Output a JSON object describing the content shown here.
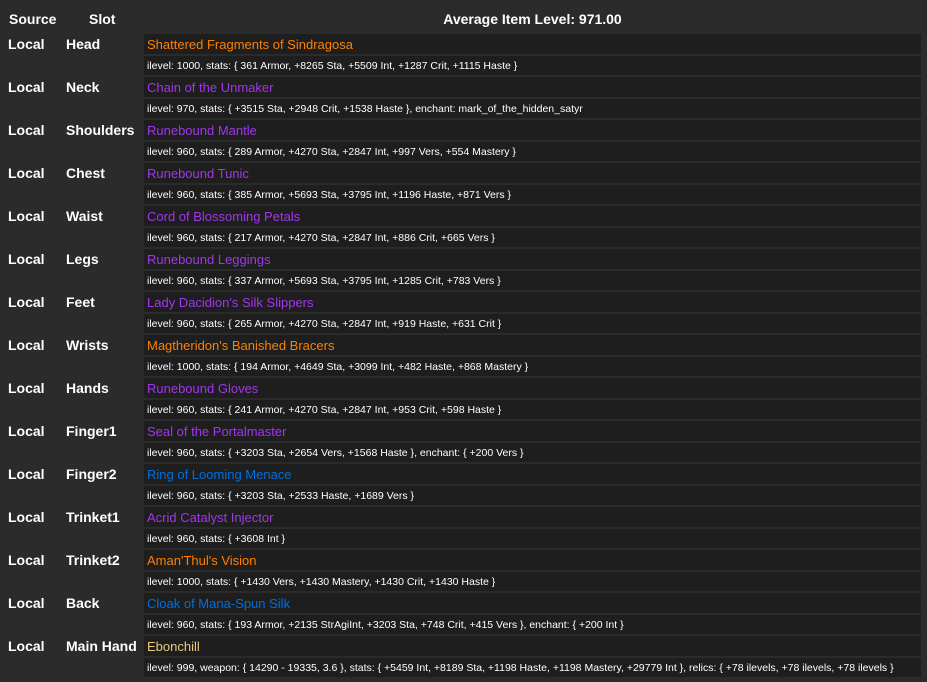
{
  "header": {
    "source": "Source",
    "slot": "Slot",
    "average_item_level": "Average Item Level: 971.00"
  },
  "quality_colors": {
    "legendary": "#ff8000",
    "epic": "#a335ee",
    "rare": "#0070dd",
    "artifact": "#e6cc80"
  },
  "items": [
    {
      "source": "Local",
      "slot": "Head",
      "name": "Shattered Fragments of Sindragosa",
      "quality": "legendary",
      "stats": "ilevel: 1000, stats: { 361 Armor, +8265 Sta, +5509 Int, +1287 Crit, +1115 Haste }"
    },
    {
      "source": "Local",
      "slot": "Neck",
      "name": "Chain of the Unmaker",
      "quality": "epic",
      "stats": "ilevel: 970, stats: { +3515 Sta, +2948 Crit, +1538 Haste }, enchant: mark_of_the_hidden_satyr"
    },
    {
      "source": "Local",
      "slot": "Shoulders",
      "name": "Runebound Mantle",
      "quality": "epic",
      "stats": "ilevel: 960, stats: { 289 Armor, +4270 Sta, +2847 Int, +997 Vers, +554 Mastery }"
    },
    {
      "source": "Local",
      "slot": "Chest",
      "name": "Runebound Tunic",
      "quality": "epic",
      "stats": "ilevel: 960, stats: { 385 Armor, +5693 Sta, +3795 Int, +1196 Haste, +871 Vers }"
    },
    {
      "source": "Local",
      "slot": "Waist",
      "name": "Cord of Blossoming Petals",
      "quality": "epic",
      "stats": "ilevel: 960, stats: { 217 Armor, +4270 Sta, +2847 Int, +886 Crit, +665 Vers }"
    },
    {
      "source": "Local",
      "slot": "Legs",
      "name": "Runebound Leggings",
      "quality": "epic",
      "stats": "ilevel: 960, stats: { 337 Armor, +5693 Sta, +3795 Int, +1285 Crit, +783 Vers }"
    },
    {
      "source": "Local",
      "slot": "Feet",
      "name": "Lady Dacidion's Silk Slippers",
      "quality": "epic",
      "stats": "ilevel: 960, stats: { 265 Armor, +4270 Sta, +2847 Int, +919 Haste, +631 Crit }"
    },
    {
      "source": "Local",
      "slot": "Wrists",
      "name": "Magtheridon's Banished Bracers",
      "quality": "legendary",
      "stats": "ilevel: 1000, stats: { 194 Armor, +4649 Sta, +3099 Int, +482 Haste, +868 Mastery }"
    },
    {
      "source": "Local",
      "slot": "Hands",
      "name": "Runebound Gloves",
      "quality": "epic",
      "stats": "ilevel: 960, stats: { 241 Armor, +4270 Sta, +2847 Int, +953 Crit, +598 Haste }"
    },
    {
      "source": "Local",
      "slot": "Finger1",
      "name": "Seal of the Portalmaster",
      "quality": "epic",
      "stats": "ilevel: 960, stats: { +3203 Sta, +2654 Vers, +1568 Haste }, enchant: { +200 Vers }"
    },
    {
      "source": "Local",
      "slot": "Finger2",
      "name": "Ring of Looming Menace",
      "quality": "rare",
      "stats": "ilevel: 960, stats: { +3203 Sta, +2533 Haste, +1689 Vers }"
    },
    {
      "source": "Local",
      "slot": "Trinket1",
      "name": "Acrid Catalyst Injector",
      "quality": "epic",
      "stats": "ilevel: 960, stats: { +3608 Int }"
    },
    {
      "source": "Local",
      "slot": "Trinket2",
      "name": "Aman'Thul's Vision",
      "quality": "legendary",
      "stats": "ilevel: 1000, stats: { +1430 Vers, +1430 Mastery, +1430 Crit, +1430 Haste }"
    },
    {
      "source": "Local",
      "slot": "Back",
      "name": "Cloak of Mana-Spun Silk",
      "quality": "rare",
      "stats": "ilevel: 960, stats: { 193 Armor, +2135 StrAgiInt, +3203 Sta, +748 Crit, +415 Vers }, enchant: { +200 Int }"
    },
    {
      "source": "Local",
      "slot": "Main Hand",
      "name": "Ebonchill",
      "quality": "artifact",
      "stats": "ilevel: 999, weapon: { 14290 - 19335, 3.6 }, stats: { +5459 Int, +8189 Sta, +1198 Haste, +1198 Mastery, +29779 Int }, relics: { +78 ilevels, +78 ilevels, +78 ilevels }"
    }
  ]
}
